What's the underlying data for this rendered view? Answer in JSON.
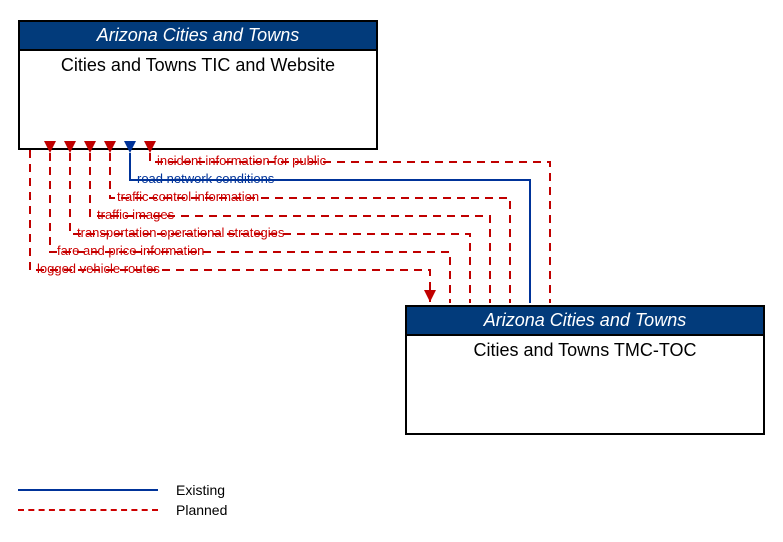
{
  "nodes": {
    "top": {
      "header": "Arizona Cities and Towns",
      "title": "Cities and Towns TIC and Website"
    },
    "bottom": {
      "header": "Arizona Cities and Towns",
      "title": "Cities and Towns TMC-TOC"
    }
  },
  "flows": [
    {
      "label": "incident information for public",
      "status": "planned",
      "direction": "to_top"
    },
    {
      "label": "road network conditions",
      "status": "existing",
      "direction": "to_top"
    },
    {
      "label": "traffic control information",
      "status": "planned",
      "direction": "to_top"
    },
    {
      "label": "traffic images",
      "status": "planned",
      "direction": "to_top"
    },
    {
      "label": "transportation operational strategies",
      "status": "planned",
      "direction": "to_top"
    },
    {
      "label": "fare and price information",
      "status": "planned",
      "direction": "to_top"
    },
    {
      "label": "logged vehicle routes",
      "status": "planned",
      "direction": "to_bottom"
    }
  ],
  "legend": {
    "existing": "Existing",
    "planned": "Planned"
  },
  "colors": {
    "existing": "#003399",
    "planned": "#c00000"
  }
}
